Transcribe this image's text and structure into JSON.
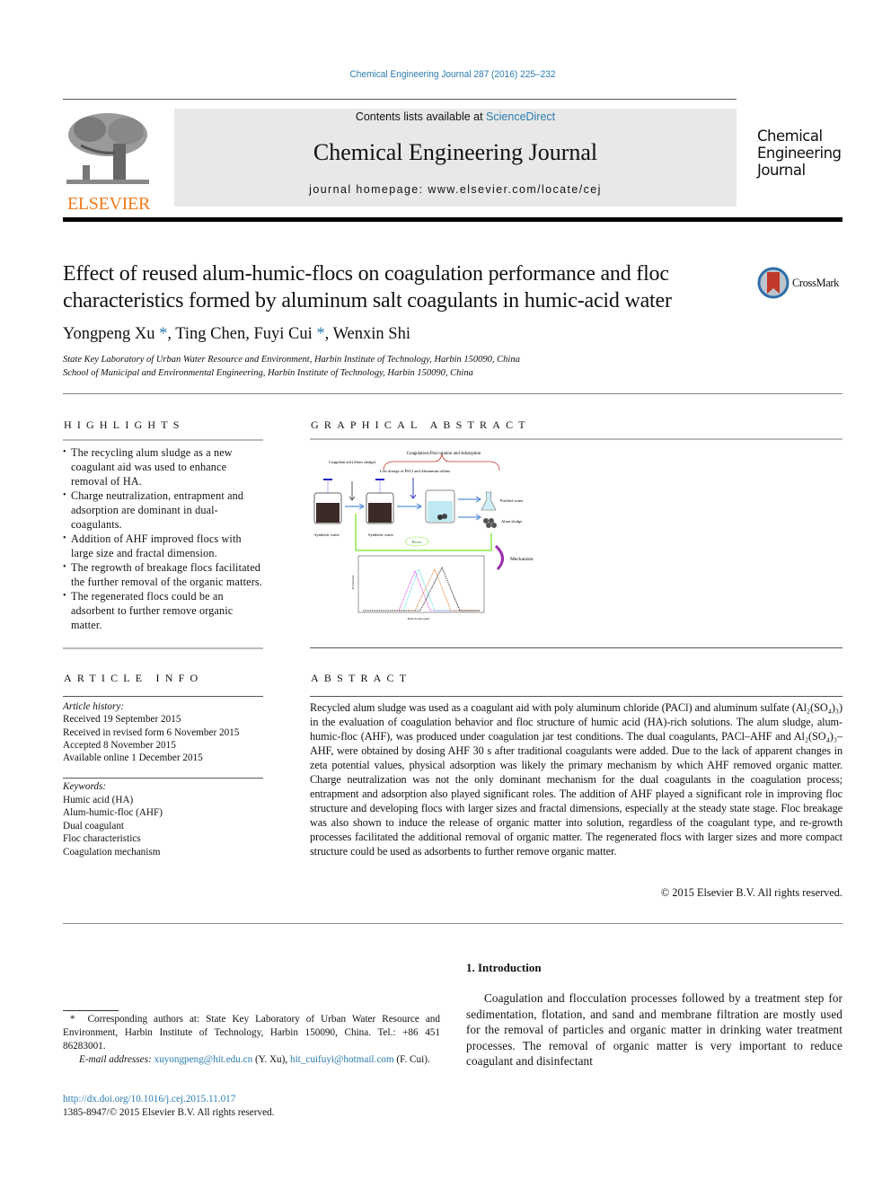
{
  "header": {
    "citation": "Chemical Engineering Journal 287 (2016) 225–232",
    "publisher_logo_text": "ELSEVIER",
    "contents_prefix": "Contents lists available at ",
    "contents_link": "ScienceDirect",
    "journal_name": "Chemical Engineering Journal",
    "homepage": "journal homepage: www.elsevier.com/locate/cej",
    "journal_logo_lines": [
      "Chemical",
      "Engineering",
      "Journal"
    ]
  },
  "article": {
    "title": "Effect of reused alum-humic-flocs on coagulation performance and floc characteristics formed by aluminum salt coagulants in humic-acid water",
    "crossmark_label": "CrossMark",
    "authors": [
      {
        "name": "Yongpeng Xu",
        "mark": "*",
        "sep": ", "
      },
      {
        "name": "Ting Chen",
        "mark": "",
        "sep": ", "
      },
      {
        "name": "Fuyi Cui",
        "mark": "*",
        "sep": ", "
      },
      {
        "name": "Wenxin Shi",
        "mark": "",
        "sep": ""
      }
    ],
    "affiliations": [
      "State Key Laboratory of Urban Water Resource and Environment, Harbin Institute of Technology, Harbin 150090, China",
      "School of Municipal and Environmental Engineering, Harbin Institute of Technology, Harbin 150090, China"
    ]
  },
  "highlights": {
    "heading": "HIGHLIGHTS",
    "items": [
      "The recycling alum sludge as a new coagulant aid was used to enhance removal of HA.",
      "Charge neutralization, entrapment and adsorption are dominant in dual-coagulants.",
      "Addition of AHF improved flocs with large size and fractal dimension.",
      "The regrowth of breakage flocs facilitated the further removal of the organic matters.",
      "The regenerated flocs could be an adsorbent to further remove organic matter."
    ]
  },
  "graphical_abstract": {
    "heading": "GRAPHICAL ABSTRACT",
    "labels": {
      "process": "Coagulation/Flocculation and Adsorption",
      "coagulant_aid": "Coagulant aid (Alum sludge)",
      "low_dosage": "Low dosage of PACl and Aluminum sulfate",
      "synthetic_water_1": "Synthetic water",
      "synthetic_water_2": "Synthetic water",
      "purified_water": "Purified water",
      "alum_sludge": "Alum sludge",
      "reuse": "Reuse",
      "mechanism": "Mechanism",
      "ylabel": "Probability",
      "xlabel": "Particle size (μm)"
    }
  },
  "article_info": {
    "heading": "ARTICLE INFO",
    "history_label": "Article history:",
    "history": [
      "Received 19 September 2015",
      "Received in revised form 6 November 2015",
      "Accepted 8 November 2015",
      "Available online 1 December 2015"
    ],
    "keywords_label": "Keywords:",
    "keywords": [
      "Humic acid (HA)",
      "Alum-humic-floc (AHF)",
      "Dual coagulant",
      "Floc characteristics",
      "Coagulation mechanism"
    ]
  },
  "abstract": {
    "heading": "ABSTRACT",
    "text": "Recycled alum sludge was used as a coagulant aid with poly aluminum chloride (PACl) and aluminum sulfate (Al₂(SO₄)₃) in the evaluation of coagulation behavior and floc structure of humic acid (HA)-rich solutions. The alum sludge, alum-humic-floc (AHF), was produced under coagulation jar test conditions. The dual coagulants, PACl–AHF and Al₂(SO₄)₃–AHF, were obtained by dosing AHF 30 s after traditional coagulants were added. Due to the lack of apparent changes in zeta potential values, physical adsorption was likely the primary mechanism by which AHF removed organic matter. Charge neutralization was not the only dominant mechanism for the dual coagulants in the coagulation process; entrapment and adsorption also played significant roles. The addition of AHF played a significant role in improving floc structure and developing flocs with larger sizes and fractal dimensions, especially at the steady state stage. Floc breakage was also shown to induce the release of organic matter into solution, regardless of the coagulant type, and re-growth processes facilitated the additional removal of organic matter. The regenerated flocs with larger sizes and more compact structure could be used as adsorbents to further remove organic matter.",
    "copyright": "© 2015 Elsevier B.V. All rights reserved."
  },
  "footnotes": {
    "corresponding": "Corresponding authors at: State Key Laboratory of Urban Water Resource and Environment, Harbin Institute of Technology, Harbin 150090, China. Tel.: +86 451 86283001.",
    "corresponding_mark": "*",
    "email_label": "E-mail addresses:",
    "email1": "xuyongpeng@hit.edu.cn",
    "email1_who": " (Y. Xu), ",
    "email2": "hit_cuifuyi@hotmail.com",
    "email2_who": " (F. Cui).",
    "doi": "http://dx.doi.org/10.1016/j.cej.2015.11.017",
    "issn": "1385-8947/© 2015 Elsevier B.V. All rights reserved."
  },
  "introduction": {
    "heading": "1. Introduction",
    "text": "Coagulation and flocculation processes followed by a treatment step for sedimentation, flotation, and sand and membrane filtration are mostly used for the removal of particles and organic matter in drinking water treatment processes. The removal of organic matter is very important to reduce coagulant and disinfectant"
  },
  "colors": {
    "link": "#2a7db0",
    "elsevier_orange": "#f07a1a",
    "banner_bg": "#e8e8e8",
    "reuse_green": "#8ee84a",
    "mechanism_purple": "#9b2fae"
  }
}
